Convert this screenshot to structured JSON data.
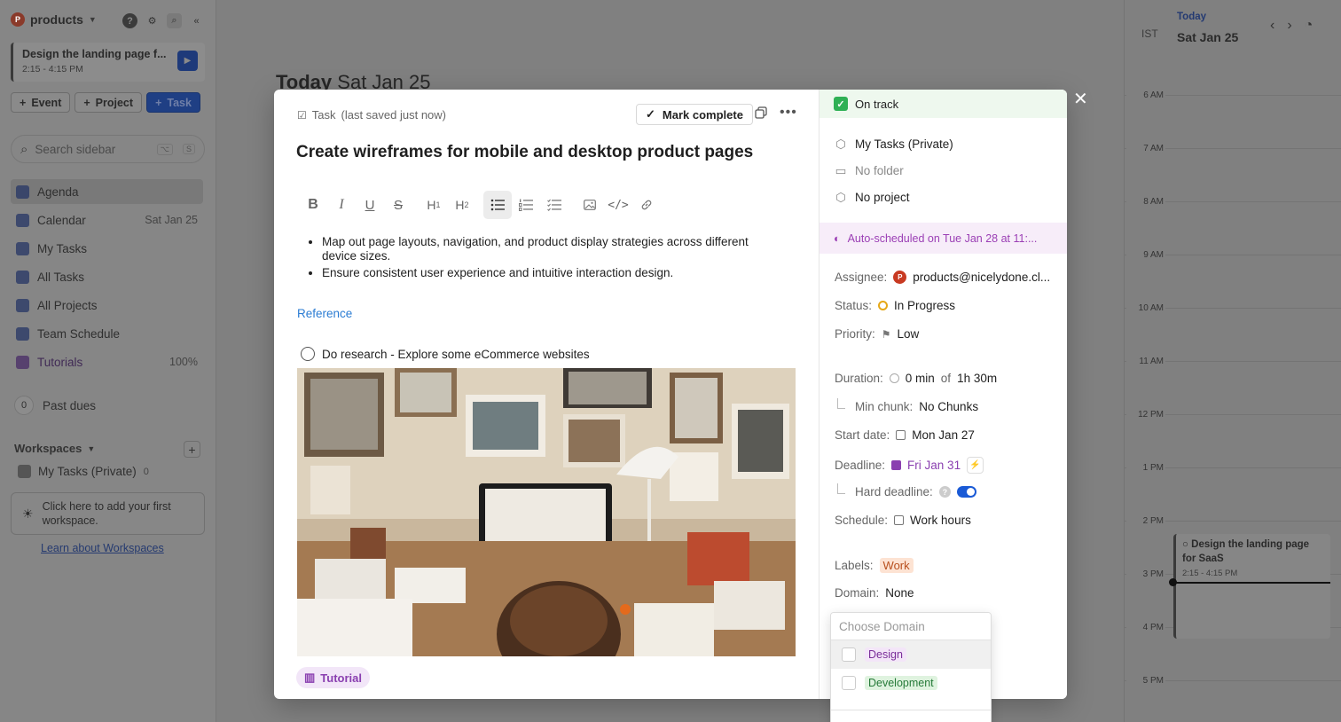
{
  "sidebar": {
    "workspace_initial": "P",
    "workspace_name": "products",
    "current_task": {
      "title": "Design the landing page f...",
      "time": "2:15 - 4:15 PM"
    },
    "buttons": {
      "event": "Event",
      "project": "Project",
      "task": "Task"
    },
    "search_placeholder": "Search sidebar",
    "search_shortcut": [
      "⌥",
      "S"
    ],
    "nav": [
      {
        "label": "Agenda",
        "right": ""
      },
      {
        "label": "Calendar",
        "right": "Sat Jan 25"
      },
      {
        "label": "My Tasks",
        "right": ""
      },
      {
        "label": "All Tasks",
        "right": ""
      },
      {
        "label": "All Projects",
        "right": ""
      },
      {
        "label": "Team Schedule",
        "right": ""
      },
      {
        "label": "Tutorials",
        "right": "100%"
      }
    ],
    "past_dues": {
      "count": "0",
      "label": "Past dues"
    },
    "workspaces_label": "Workspaces",
    "workspace_item": {
      "label": "My Tasks (Private)",
      "count": "0"
    },
    "hint": "Click here to add your first workspace.",
    "learn_link": "Learn about Workspaces"
  },
  "main": {
    "title_bold": "Today",
    "title_date": "Sat Jan 25"
  },
  "calendar": {
    "timezone": "IST",
    "today_label": "Today",
    "date": "Sat Jan 25",
    "hours": [
      "6 AM",
      "7 AM",
      "8 AM",
      "9 AM",
      "10 AM",
      "11 AM",
      "12 PM",
      "1 PM",
      "2 PM",
      "3 PM",
      "4 PM",
      "5 PM"
    ],
    "event": {
      "title": "Design the landing page for SaaS",
      "time": "2:15 - 4:15 PM"
    }
  },
  "modal": {
    "crumb_type": "Task",
    "crumb_saved": "(last saved just now)",
    "mark_complete": "Mark complete",
    "title": "Create wireframes for mobile and desktop product pages",
    "bullets": [
      "Map out page layouts, navigation, and product display strategies across different device sizes.",
      "Ensure consistent user experience and intuitive interaction design."
    ],
    "reference": "Reference",
    "checklist_item": "Do research - Explore some eCommerce websites",
    "tag": "Tutorial"
  },
  "details": {
    "on_track": "On track",
    "location_workspace": "My Tasks (Private)",
    "location_folder": "No folder",
    "location_project": "No project",
    "auto_scheduled": "Auto-scheduled on Tue Jan 28 at 11:...",
    "assignee_label": "Assignee:",
    "assignee_initial": "P",
    "assignee": "products@nicelydone.cl...",
    "status_label": "Status:",
    "status": "In Progress",
    "priority_label": "Priority:",
    "priority": "Low",
    "duration_label": "Duration:",
    "duration_done": "0 min",
    "duration_of": "of",
    "duration_total": "1h 30m",
    "min_chunk_label": "Min chunk:",
    "min_chunk": "No Chunks",
    "start_label": "Start date:",
    "start": "Mon Jan 27",
    "deadline_label": "Deadline:",
    "deadline": "Fri Jan 31",
    "hard_deadline_label": "Hard deadline:",
    "schedule_label": "Schedule:",
    "schedule": "Work hours",
    "labels_label": "Labels:",
    "label_work": "Work",
    "domain_label": "Domain:",
    "domain": "None"
  },
  "domain_dropdown": {
    "placeholder": "Choose Domain",
    "options": [
      "Design",
      "Development"
    ]
  },
  "colors": {
    "accent": "#1a5ad6",
    "on_track": "#2fb055",
    "auto": "#9b3fb5",
    "link": "#2b7cd3"
  }
}
